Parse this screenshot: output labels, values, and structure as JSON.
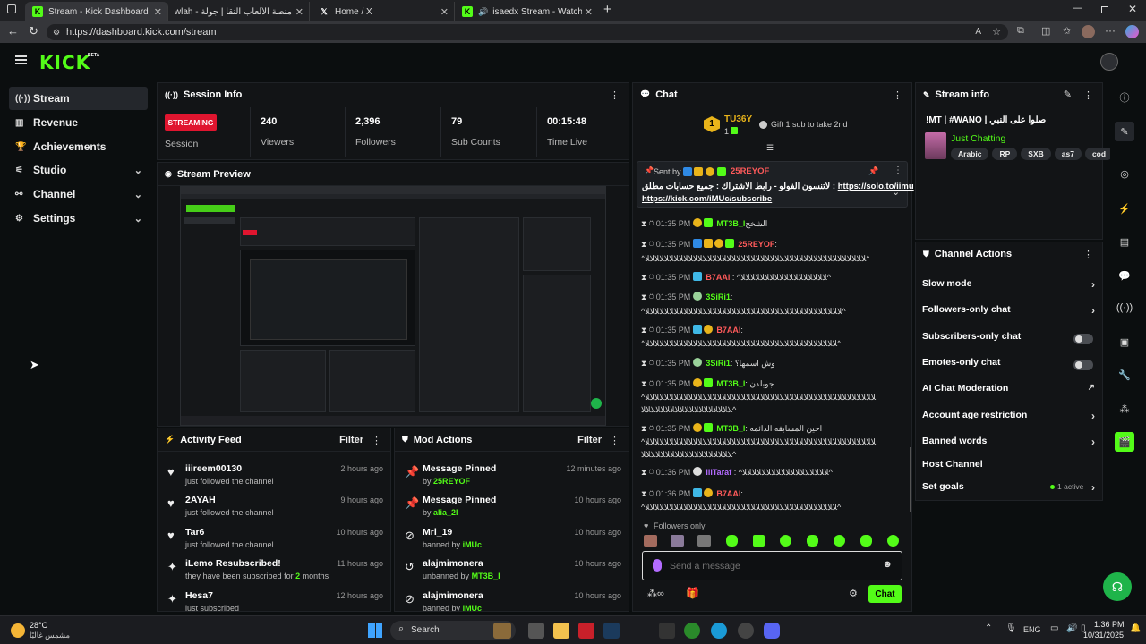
{
  "browser": {
    "tabs": [
      {
        "title": "Stream - Kick Dashboard",
        "active": true
      },
      {
        "title": "منصة الألعاب النقا | جولة - Jawlah",
        "active": false
      },
      {
        "title": "Home / X",
        "active": false
      },
      {
        "title": "isaedx Stream - Watch Live o",
        "active": false
      }
    ],
    "new_tab": "+",
    "url": "https://dashboard.kick.com/stream"
  },
  "brand": {
    "logo": "KICK",
    "beta": "BETA",
    "accent": "#53fc18"
  },
  "sidebar": {
    "items": [
      {
        "label": "Stream",
        "icon": "broadcast-icon",
        "active": true
      },
      {
        "label": "Revenue",
        "icon": "chart-icon"
      },
      {
        "label": "Achievements",
        "icon": "trophy-icon"
      },
      {
        "label": "Studio",
        "icon": "sliders-icon",
        "expandable": true
      },
      {
        "label": "Channel",
        "icon": "channel-icon",
        "expandable": true
      },
      {
        "label": "Settings",
        "icon": "gear-icon",
        "expandable": true
      }
    ]
  },
  "session_info": {
    "title": "Session Info",
    "status_badge": "STREAMING",
    "status_label": "Session",
    "stats": [
      {
        "value": "240",
        "label": "Viewers"
      },
      {
        "value": "2,396",
        "label": "Followers"
      },
      {
        "value": "79",
        "label": "Sub Counts"
      },
      {
        "value": "00:15:48",
        "label": "Time Live"
      }
    ]
  },
  "stream_preview": {
    "title": "Stream Preview"
  },
  "activity_feed": {
    "title": "Activity Feed",
    "filter": "Filter",
    "items": [
      {
        "icon": "heart-icon",
        "title": "iiireem00130",
        "sub": "just followed the channel",
        "time": "2 hours ago"
      },
      {
        "icon": "heart-icon",
        "title": "2AYAH",
        "sub": "just followed the channel",
        "time": "9 hours ago"
      },
      {
        "icon": "heart-icon",
        "title": "Tar6",
        "sub": "just followed the channel",
        "time": "10 hours ago"
      },
      {
        "icon": "sparkle-icon",
        "title": "iLemo Resubscribed!",
        "sub": "they have been subscribed for",
        "sub_num": "2",
        "sub_end": "months",
        "time": "11 hours ago"
      },
      {
        "icon": "sparkle-icon",
        "title": "Hesa7",
        "sub": "just subscribed",
        "time": "12 hours ago"
      }
    ]
  },
  "mod_actions": {
    "title": "Mod Actions",
    "filter": "Filter",
    "items": [
      {
        "icon": "pin-icon",
        "title": "Message Pinned",
        "pre": "by",
        "user": "25REYOF",
        "time": "12 minutes ago"
      },
      {
        "icon": "pin-icon",
        "title": "Message Pinned",
        "pre": "by",
        "user": "alia_2l",
        "time": "10 hours ago"
      },
      {
        "icon": "ban-icon",
        "title": "Mrl_19",
        "pre": "banned by",
        "user": "iMUc",
        "time": "10 hours ago"
      },
      {
        "icon": "unban-icon",
        "title": "alajmimonera",
        "pre": "unbanned by",
        "user": "MT3B_l",
        "time": "10 hours ago"
      },
      {
        "icon": "ban-icon",
        "title": "alajmimonera",
        "pre": "banned by",
        "user": "iMUc",
        "time": "10 hours ago"
      }
    ]
  },
  "chat": {
    "title": "Chat",
    "top_gifter": {
      "rank": "1",
      "name": "TU36Y",
      "count": "1"
    },
    "gift_hint": "Gift 1 sub to take 2nd",
    "pinned": {
      "sent_by": "Sent by",
      "user": "25REYOF",
      "text": "لاتنسون الفولو - رابط الاشتراك : جميع حسابات مطلق :",
      "link1": "https://solo.to/iimu",
      "link2": "https://kick.com/iMUc/subscribe"
    },
    "messages": [
      {
        "time": "01:35 PM",
        "user": "MT3B_l",
        "color": "#53fc18",
        "text": "الشخح"
      },
      {
        "time": "01:35 PM",
        "user": "25REYOF",
        "color": "#ff5a5a",
        "text": ":",
        "cont": "^ﻼﻼﻼﻼﻼﻼﻼﻼﻼﻼﻼﻼﻼﻼﻼﻼﻼﻼﻼﻼﻼﻼﻼﻼﻼﻼﻼﻼﻼﻼﻼﻼﻼﻼﻼﻼﻼﻼﻼﻼﻼﻼﻼﻼﻼﻼ^"
      },
      {
        "time": "01:35 PM",
        "user": "B7AAl",
        "color": "#ff5a5a",
        "text": ": ^ﻼﻼﻼﻼﻼﻼﻼﻼﻼﻼﻼﻼﻼﻼﻼﻼﻼﻼ^"
      },
      {
        "time": "01:35 PM",
        "user": "3SiRi1",
        "color": "#53fc18",
        "text": ":",
        "cont": "^ﻼﻼﻼﻼﻼﻼﻼﻼﻼﻼﻼﻼﻼﻼﻼﻼﻼﻼﻼﻼﻼﻼﻼﻼﻼﻼﻼﻼﻼﻼﻼﻼﻼﻼﻼﻼﻼﻼﻼﻼﻼ^"
      },
      {
        "time": "01:35 PM",
        "user": "B7AAl",
        "color": "#ff5a5a",
        "text": ":",
        "cont": "^ﻼﻼﻼﻼﻼﻼﻼﻼﻼﻼﻼﻼﻼﻼﻼﻼﻼﻼﻼﻼﻼﻼﻼﻼﻼﻼﻼﻼﻼﻼﻼﻼﻼﻼﻼﻼﻼﻼﻼﻼ^"
      },
      {
        "time": "01:35 PM",
        "user": "3SiRi1",
        "color": "#53fc18",
        "text": "وش اسمها؟"
      },
      {
        "time": "01:35 PM",
        "user": "MT3B_l",
        "color": "#53fc18",
        "text": "جوبلدن",
        "cont": "^ﻼﻼﻼﻼﻼﻼﻼﻼﻼﻼﻼﻼﻼﻼﻼﻼﻼﻼﻼﻼﻼﻼﻼﻼﻼﻼﻼﻼﻼﻼﻼﻼﻼﻼﻼﻼﻼﻼﻼﻼﻼﻼﻼﻼﻼﻼﻼﻼ",
        "cont2": "ﻼﻼﻼﻼﻼﻼﻼﻼﻼﻼﻼﻼﻼﻼﻼﻼﻼﻼﻼ^"
      },
      {
        "time": "01:35 PM",
        "user": "MT3B_l",
        "color": "#53fc18",
        "text": "اجين المسابقه الدائمه",
        "cont": "^ﻼﻼﻼﻼﻼﻼﻼﻼﻼﻼﻼﻼﻼﻼﻼﻼﻼﻼﻼﻼﻼﻼﻼﻼﻼﻼﻼﻼﻼﻼﻼﻼﻼﻼﻼﻼﻼﻼﻼﻼﻼﻼﻼﻼﻼﻼﻼﻼ",
        "cont2": "ﻼﻼﻼﻼﻼﻼﻼﻼﻼﻼﻼﻼﻼﻼﻼﻼﻼﻼﻼ^"
      },
      {
        "time": "01:36 PM",
        "user": "iiiTaraf",
        "color": "#b36bff",
        "text": ": ^ﻼﻼﻼﻼﻼﻼﻼﻼﻼﻼﻼﻼﻼﻼﻼﻼﻼﻼ^"
      },
      {
        "time": "01:36 PM",
        "user": "B7AAl",
        "color": "#ff5a5a",
        "text": ":",
        "cont": "^ﻼﻼﻼﻼﻼﻼﻼﻼﻼﻼﻼﻼﻼﻼﻼﻼﻼﻼﻼﻼﻼﻼﻼﻼﻼﻼﻼﻼﻼﻼﻼﻼﻼﻼﻼﻼﻼﻼﻼﻼ^"
      }
    ],
    "followers_only": "Followers only",
    "input_placeholder": "Send a message",
    "send_label": "Chat"
  },
  "stream_info": {
    "title": "Stream info",
    "stream_title": "!MT | #WANO | صلوا على النبي",
    "category": "Just Chatting",
    "tags": [
      "Arabic",
      "RP",
      "SXB",
      "as7",
      "cod"
    ]
  },
  "channel_actions": {
    "title": "Channel Actions",
    "items": [
      {
        "label": "Slow mode",
        "control": "arrow"
      },
      {
        "label": "Followers-only chat",
        "control": "arrow"
      },
      {
        "label": "Subscribers-only chat",
        "control": "toggle"
      },
      {
        "label": "Emotes-only chat",
        "control": "toggle"
      },
      {
        "label": "AI Chat Moderation",
        "control": "external"
      },
      {
        "label": "Account age restriction",
        "control": "arrow"
      },
      {
        "label": "Banned words",
        "control": "arrow"
      },
      {
        "label": "Host Channel",
        "control": "none"
      },
      {
        "label": "Set goals",
        "control": "arrow",
        "status": "1 active"
      }
    ]
  },
  "taskbar": {
    "weather_temp": "28°C",
    "weather_desc": "مشمس غالبًا",
    "search": "Search",
    "lang": "ENG",
    "time": "1:36 PM",
    "date": "10/31/2025"
  }
}
